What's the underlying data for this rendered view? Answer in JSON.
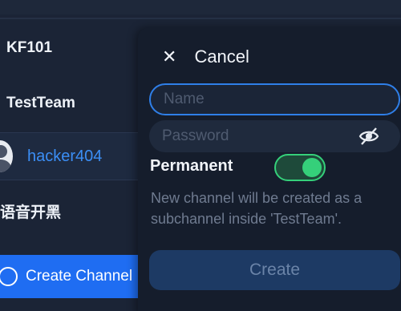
{
  "channels": {
    "server_name": "KF101",
    "team_name": "TestTeam",
    "user_name": "hacker404",
    "chinese_channel": "语音开黑"
  },
  "sidebar": {
    "create_channel_label": "Create Channel"
  },
  "popup": {
    "cancel_label": "Cancel",
    "name_placeholder": "Name",
    "password_placeholder": "Password",
    "permanent_label": "Permanent",
    "permanent_enabled": true,
    "hint_text": "New channel will be created as a subchannel inside 'TestTeam'.",
    "create_label": "Create"
  },
  "colors": {
    "accent": "#1f6df2",
    "toggle_on": "#35d07a",
    "user_link": "#3b8ef5"
  }
}
